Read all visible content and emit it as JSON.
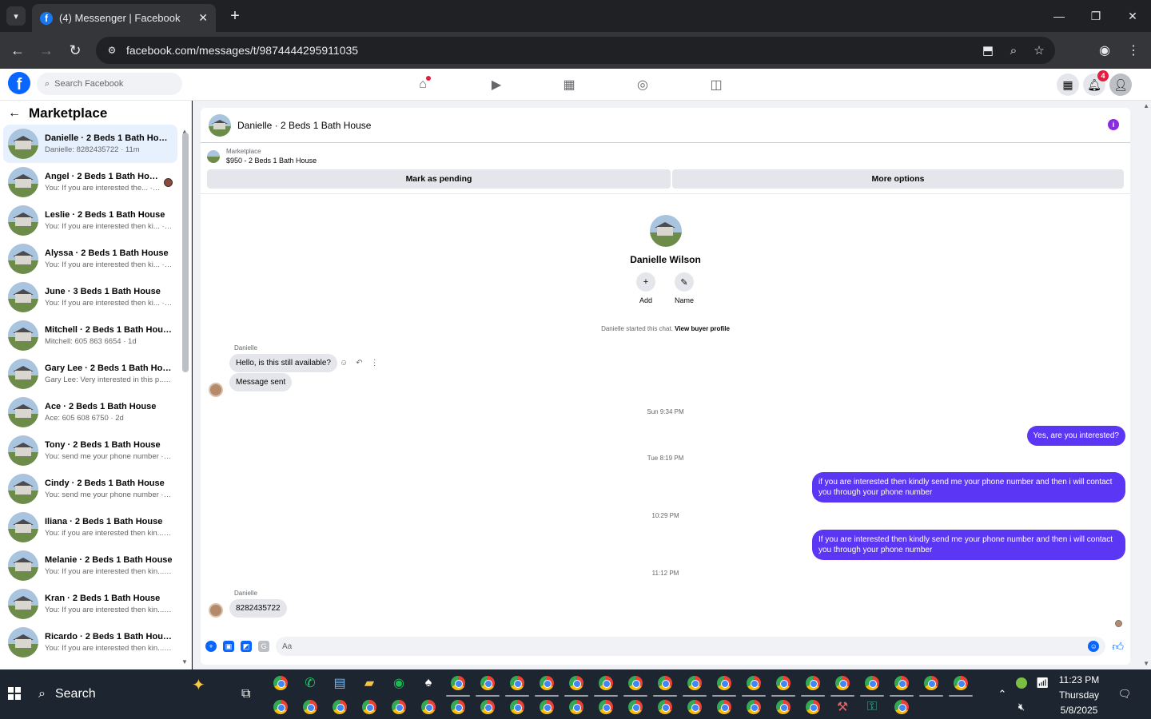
{
  "browser": {
    "tab_title": "(4) Messenger | Facebook",
    "url": "facebook.com/messages/t/9874444295911035"
  },
  "fb": {
    "search_placeholder": "Search Facebook",
    "notification_count": "4"
  },
  "sidebar": {
    "title": "Marketplace",
    "conversations": [
      {
        "name": "Danielle · 2 Beds 1 Bath House",
        "snippet": "Danielle: 8282435722 · 11m",
        "active": true
      },
      {
        "name": "Angel · 2 Beds 1 Bath House",
        "snippet": "You: If you are interested the... · 54m"
      },
      {
        "name": "Leslie · 2 Beds 1 Bath House",
        "snippet": "You: If you are interested then ki... · 54m"
      },
      {
        "name": "Alyssa · 2 Beds 1 Bath House",
        "snippet": "You: If you are interested then ki... · 54m"
      },
      {
        "name": "June · 3 Beds 1 Bath House",
        "snippet": "You: If you are interested then ki... · 54m"
      },
      {
        "name": "Mitchell · 2 Beds 1 Bath House",
        "snippet": "Mitchell: 605 863 6654 · 1d"
      },
      {
        "name": "Gary Lee · 2 Beds 1 Bath House",
        "snippet": "Gary Lee: Very interested in this p... · 2d"
      },
      {
        "name": "Ace · 2 Beds 1 Bath House",
        "snippet": "Ace: 605 608 6750 · 2d"
      },
      {
        "name": "Tony · 2 Beds 1 Bath House",
        "snippet": "You: send me your phone number · 1w"
      },
      {
        "name": "Cindy · 2 Beds 1 Bath House",
        "snippet": "You: send me your phone number · 1w"
      },
      {
        "name": "Iliana · 2 Beds 1 Bath House",
        "snippet": "You: if you are interested then kin... · 1w"
      },
      {
        "name": "Melanie · 2 Beds 1 Bath House",
        "snippet": "You: If you are interested then kin... · 2w"
      },
      {
        "name": "Kran · 2 Beds 1 Bath House",
        "snippet": "You: If you are interested then kin... · 2w"
      },
      {
        "name": "Ricardo · 2 Beds 1 Bath House",
        "snippet": "You: If you are interested then kin... · 2w"
      }
    ]
  },
  "chat": {
    "header_title": "Danielle · 2 Beds 1 Bath House",
    "listing_label": "Marketplace",
    "listing_title": "$950 - 2 Beds 1 Bath House",
    "mark_pending": "Mark as pending",
    "more_options": "More options",
    "profile_name": "Danielle Wilson",
    "add_label": "Add",
    "name_label": "Name",
    "started_text": "Danielle started this chat.",
    "view_profile": "View buyer profile",
    "sender_name": "Danielle",
    "msg1": "Hello, is this still available?",
    "msg2": "Message sent",
    "ts1": "Sun 9:34 PM",
    "out1": "Yes, are you interested?",
    "ts2": "Tue 8:19 PM",
    "out2": "if you are interested then kindly send me your phone number and then i will contact you through your phone number",
    "ts3": "10:29 PM",
    "out3": "If you are interested then kindly send me your phone number and then i will contact you through your phone number",
    "ts4": "11:12 PM",
    "sender_name2": "Danielle",
    "msg3": "8282435722",
    "composer_placeholder": "Aa"
  },
  "taskbar": {
    "search_label": "Search",
    "time": "11:23 PM",
    "day": "Thursday",
    "date": "5/8/2025"
  },
  "colors": {
    "messenger_purple": "#5b36f5",
    "fb_blue": "#0866ff",
    "active_conv": "#e7f0fd"
  }
}
